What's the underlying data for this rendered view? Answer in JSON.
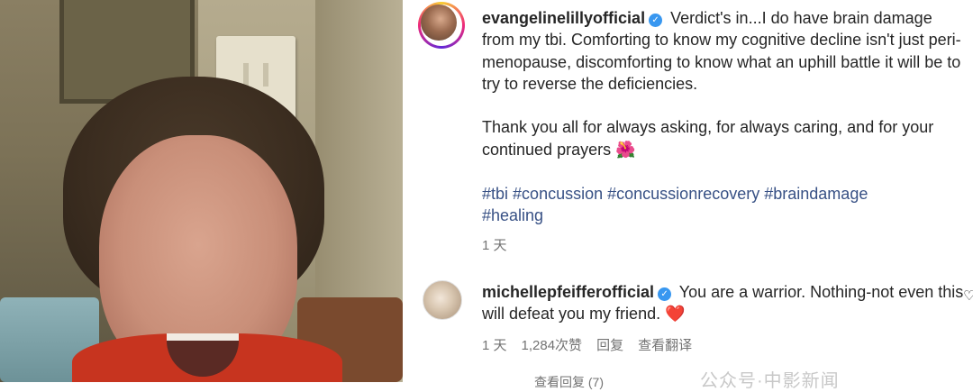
{
  "post": {
    "username": "evangelinelillyofficial",
    "caption_p1": "Verdict's in...I do have brain damage from my tbi. Comforting to know my cognitive decline isn't just peri-menopause, discomforting to know what an uphill battle it will be to try to reverse the deficiencies.",
    "caption_p2": "Thank you all for always asking, for always caring, and for your continued prayers",
    "caption_emoji": "🌺",
    "hashtags": [
      "#tbi",
      "#concussion",
      "#concussionrecovery",
      "#braindamage",
      "#healing"
    ],
    "time": "1 天"
  },
  "comment": {
    "username": "michellepfeifferofficial",
    "text": "You are a warrior. Nothing-not even this will defeat you my friend.",
    "emoji": "❤️",
    "time": "1 天",
    "likes": "1,284次赞",
    "reply_label": "回复",
    "translate_label": "查看翻译",
    "view_replies": "查看回复 (7)"
  },
  "watermark": "公众号·中影新闻",
  "icons": {
    "verified": "verified-badge-icon",
    "like": "heart-outline-icon"
  },
  "colors": {
    "hashtag": "#385185",
    "verified": "#3897f0",
    "meta": "#737373"
  }
}
